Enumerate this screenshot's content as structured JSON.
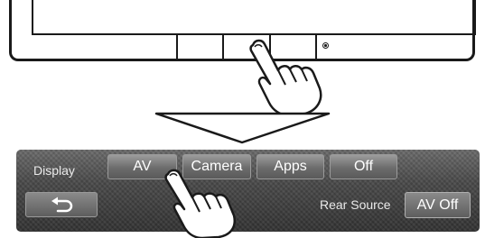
{
  "menu": {
    "display_label": "Display",
    "tabs": [
      {
        "label": "AV"
      },
      {
        "label": "Camera"
      },
      {
        "label": "Apps"
      },
      {
        "label": "Off"
      }
    ],
    "rear_source_label": "Rear Source",
    "av_off_label": "AV Off"
  },
  "icons": {
    "back": "back-arrow-icon",
    "pointer": "hand-pointer-icon",
    "down_arrow": "down-arrow-icon"
  },
  "colors": {
    "panel_bg": "#4a4a4a",
    "button_bg": "#6c6c6c",
    "text": "#ffffff"
  }
}
